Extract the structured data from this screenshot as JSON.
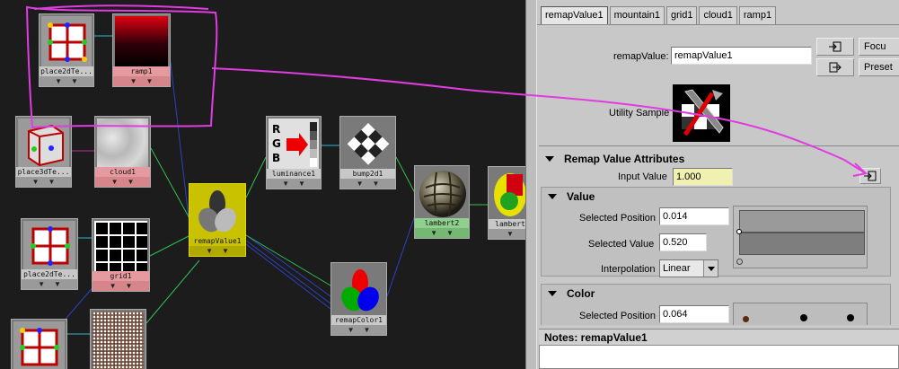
{
  "graph": {
    "nodes": [
      {
        "id": "place2dTexture1",
        "label": "place2dTe...",
        "kind": "place2d",
        "color": "gray"
      },
      {
        "id": "ramp1",
        "label": "ramp1",
        "kind": "ramp",
        "color": "pink"
      },
      {
        "id": "place3dTexture",
        "label": "place3dTe...",
        "kind": "place3d",
        "color": "gray"
      },
      {
        "id": "cloud1",
        "label": "cloud1",
        "kind": "cloud",
        "color": "pink"
      },
      {
        "id": "place2dTexture2",
        "label": "place2dTe...",
        "kind": "place2d",
        "color": "gray"
      },
      {
        "id": "grid1",
        "label": "grid1",
        "kind": "grid",
        "color": "pink"
      },
      {
        "id": "place2dTexture3",
        "label": "",
        "kind": "place2d",
        "color": "gray"
      },
      {
        "id": "mountain1",
        "label": "",
        "kind": "noise",
        "color": "pink"
      },
      {
        "id": "remapValue1",
        "label": "remapValue1",
        "kind": "remapValue",
        "color": "yellow"
      },
      {
        "id": "luminance1",
        "label": "luminance1",
        "kind": "luminance",
        "color": "gray"
      },
      {
        "id": "bump2d1",
        "label": "bump2d1",
        "kind": "bump",
        "color": "gray"
      },
      {
        "id": "lambert2",
        "label": "lambert2",
        "kind": "lambert",
        "color": "green"
      },
      {
        "id": "lambert_sg",
        "label": "lambert",
        "kind": "shadingGroup",
        "color": "gray"
      },
      {
        "id": "remapColor1",
        "label": "remapColor1",
        "kind": "remapColor",
        "color": "gray"
      }
    ],
    "port_glyph": "▼"
  },
  "attribute_editor": {
    "tabs": [
      {
        "label": "remapValue1",
        "active": true
      },
      {
        "label": "mountain1",
        "active": false
      },
      {
        "label": "grid1",
        "active": false
      },
      {
        "label": "cloud1",
        "active": false
      },
      {
        "label": "ramp1",
        "active": false
      }
    ],
    "node_type_label": "remapValue:",
    "node_name_value": "remapValue1",
    "focus_label": "Focu",
    "presets_label": "Preset",
    "swatch_label": "Utility Sample",
    "section_title": "Remap Value Attributes",
    "input_value_label": "Input Value",
    "input_value": "1.000",
    "value_section": {
      "title": "Value",
      "selected_position_label": "Selected Position",
      "selected_position": "0.014",
      "selected_value_label": "Selected Value",
      "selected_value": "0.520",
      "interpolation_label": "Interpolation",
      "interpolation": "Linear"
    },
    "color_section": {
      "title": "Color",
      "selected_position_label": "Selected Position",
      "selected_position": "0.064"
    },
    "notes_label": "Notes: remapValue1"
  },
  "colors": {
    "annotation": "#e03ce0",
    "graph_bg": "#1c1c1c",
    "ramp_node": "#e59aa0",
    "remap_node": "#c9c200",
    "input_field_bg": "#f0f0b0"
  }
}
